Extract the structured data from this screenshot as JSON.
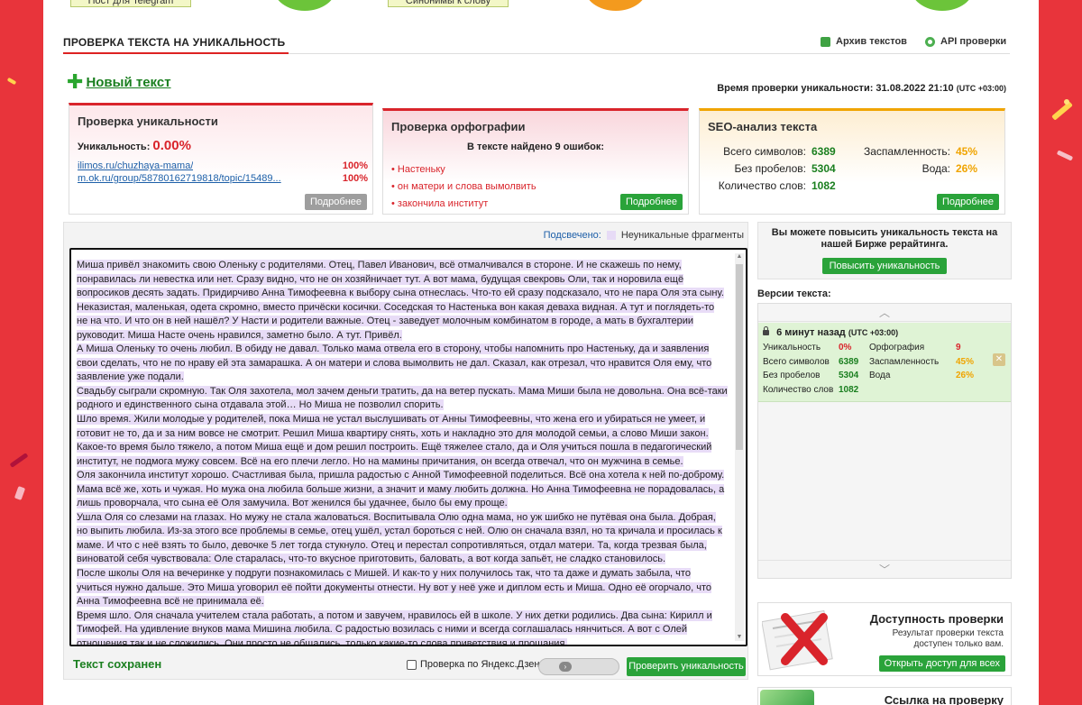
{
  "promo": {
    "telegram_label": "Пост для Telegram",
    "synonyms_label": "Синонимы к слову"
  },
  "colors": {
    "accent_red": "#d9242b",
    "brand_green": "#2aa33a",
    "highlight": "#e8dcf7",
    "seo_orange": "#f0a400"
  },
  "header": {
    "title": "ПРОВЕРКА ТЕКСТА НА УНИКАЛЬНОСТЬ",
    "archive_label": "Архив текстов",
    "archive_icon": "archive-icon",
    "api_label": "API проверки",
    "api_icon": "gear-icon"
  },
  "new_text": {
    "label": "Новый текст",
    "icon": "plus-icon"
  },
  "check_time": {
    "label": "Время проверки уникальности: 31.08.2022 21:10",
    "tz": "(UTC +03:00)"
  },
  "uniqueness_card": {
    "title": "Проверка уникальности",
    "uniqueness_label": "Уникальность:",
    "uniqueness_value": "0.00%",
    "sources": [
      {
        "url": "ilimos.ru/chuzhaya-mama/",
        "percent": "100%"
      },
      {
        "url": "m.ok.ru/group/58780162719818/topic/15489...",
        "percent": "100%"
      }
    ],
    "more_label": "Подробнее"
  },
  "spelling_card": {
    "title": "Проверка орфографии",
    "errors_heading": "В тексте найдено 9 ошибок:",
    "errors": [
      "Настеньку",
      "он матери и слова вымолвить",
      "закончила институт"
    ],
    "more_label": "Подробнее"
  },
  "seo_card": {
    "title": "SEO-анализ текста",
    "total_chars_label": "Всего символов:",
    "total_chars": "6389",
    "no_spaces_label": "Без пробелов:",
    "no_spaces": "5304",
    "words_label": "Количество слов:",
    "words": "1082",
    "spam_label": "Заспамленность:",
    "spam": "45%",
    "water_label": "Вода:",
    "water": "26%",
    "more_label": "Подробнее"
  },
  "legend": {
    "highlighted_label": "Подсвечено:",
    "nonunique_label": "Неуникальные фрагменты"
  },
  "text": {
    "paragraphs": [
      "Миша привёл знакомить свою Оленьку с родителями. Отец, Павел Иванович, всё отмалчивался в стороне. И не скажешь по нему, понравилась ли невестка или нет. Сразу видно, что не он хозяйничает тут. А вот мама, будущая свекровь Оли, так и норовила ещё вопросиков десять задать. Придирчиво Анна Тимофеевна к выбору сына отнеслась. Что-то ей сразу подсказало, что не пара Оля эта сыну.",
      "Неказистая, маленькая, одета скромно, вместо причёски косички. Соседская то Настенька вон какая деваха видная. А тут и поглядеть-то не на что. И что он в ней нашёл? У Насти и родители важные. Отец - заведует молочным комбинатом в городе, а мать в бухгалтерии руководит. Миша Насте очень нравился, заметно было. А тут. Привёл.",
      "А Миша Оленьку то очень любил. В обиду не давал. Только мама отвела его в сторону, чтобы напомнить про Настеньку, да и заявления свои сделать, что не по нраву ей эта замарашка. А он матери и слова вымолвить не дал. Сказал, как отрезал, что нравится Оля ему, что заявление уже подали.",
      "Свадьбу сыграли скромную. Так Оля захотела, мол зачем деньги тратить, да на ветер пускать. Мама Миши была не довольна. Она всё-таки родного и единственного сына отдавала этой… Но Миша не позволил спорить.",
      "Шло время. Жили молодые у родителей, пока Миша не устал выслушивать от Анны Тимофеевны, что жена его и убираться не умеет, и готовит не то, да и за ним вовсе не смотрит. Решил Миша квартиру снять, хоть и накладно это для молодой семьи, а слово Миши закон.",
      "Какое-то время было тяжело, а потом Миша ещё и дом решил построить. Ещё тяжелее стало, да и Оля учиться пошла в педагогический институт, не подмога мужу совсем. Всё на его плечи легло. Но на мамины причитания, он всегда отвечал, что он мужчина в семье.",
      "Оля закончила институт хорошо. Счастливая была, пришла радостью с Анной Тимофеевной поделиться. Всё она хотела к ней по-доброму. Мама всё же, хоть и чужая. Но мужа она любила больше жизни, а значит и маму любить должна. Но Анна Тимофеевна не порадовалась, а лишь проворчала, что сына её Оля замучила. Вот женился бы удачнее, было бы ему проще.",
      "Ушла Оля со слезами на глазах. Но мужу не стала жаловаться. Воспитывала Олю одна мама, но уж шибко не путёвая она была. Добрая, но выпить любила. Из-за этого все проблемы в семье, отец ушёл, устал бороться с ней. Олю он сначала взял, но та кричала и просилась к маме. И что с неё взять то было, девочке 5 лет тогда стукнуло. Отец и перестал сопротивляться, отдал матери. Та, когда трезвая была, виноватой себя чувствовала: Оле старалась, что-то вкусное приготовить, баловать, а вот когда запьёт, не сладко становилось.",
      "После школы Оля на вечеринке у подруги познакомилась с Мишей. И как-то у них получилось так, что та даже и думать забыла, что учиться нужно дальше. Это Миша уговорил её пойти документы отнести. Ну вот у неё уже и диплом есть и Миша. Одно её огорчало, что Анна Тимофеевна всё не принимала её.",
      "Время шло. Оля сначала учителем стала работать, а потом и завучем, нравилось ей в школе. У них детки родились. Два сына: Кирилл и Тимофей. На удивление внуков мама Мишина любила. С радостью возилась с ними и всегда соглашалась нянчиться. А вот с Олей отношения так и не сложились. Они просто не общались, только какие-то слова приветствия и прощания."
    ]
  },
  "bottom_bar": {
    "saved_label": "Текст сохранен",
    "dzen_label": "Проверка по Яндекс.Дзен",
    "check_button": "Проверить уникальность"
  },
  "upsell": {
    "text": "Вы можете повысить уникальность текста на нашей Бирже рерайтинга.",
    "button": "Повысить уникальность"
  },
  "versions": {
    "label": "Версии текста:",
    "items": [
      {
        "time": "6 минут назад",
        "tz": "(UTC +03:00)",
        "uniqueness_label": "Уникальность",
        "uniqueness": "0%",
        "spelling_label": "Орфография",
        "spelling": "9",
        "total_label": "Всего символов",
        "total": "6389",
        "spam_label": "Заспамленность",
        "spam": "45%",
        "nospace_label": "Без пробелов",
        "nospace": "5304",
        "water_label": "Вода",
        "water": "26%",
        "words_label": "Количество слов",
        "words": "1082"
      }
    ]
  },
  "access": {
    "title": "Доступность проверки",
    "desc": "Результат проверки текста доступен только вам.",
    "button": "Открыть доступ для всех"
  },
  "link_check": {
    "title": "Ссылка на проверку"
  }
}
